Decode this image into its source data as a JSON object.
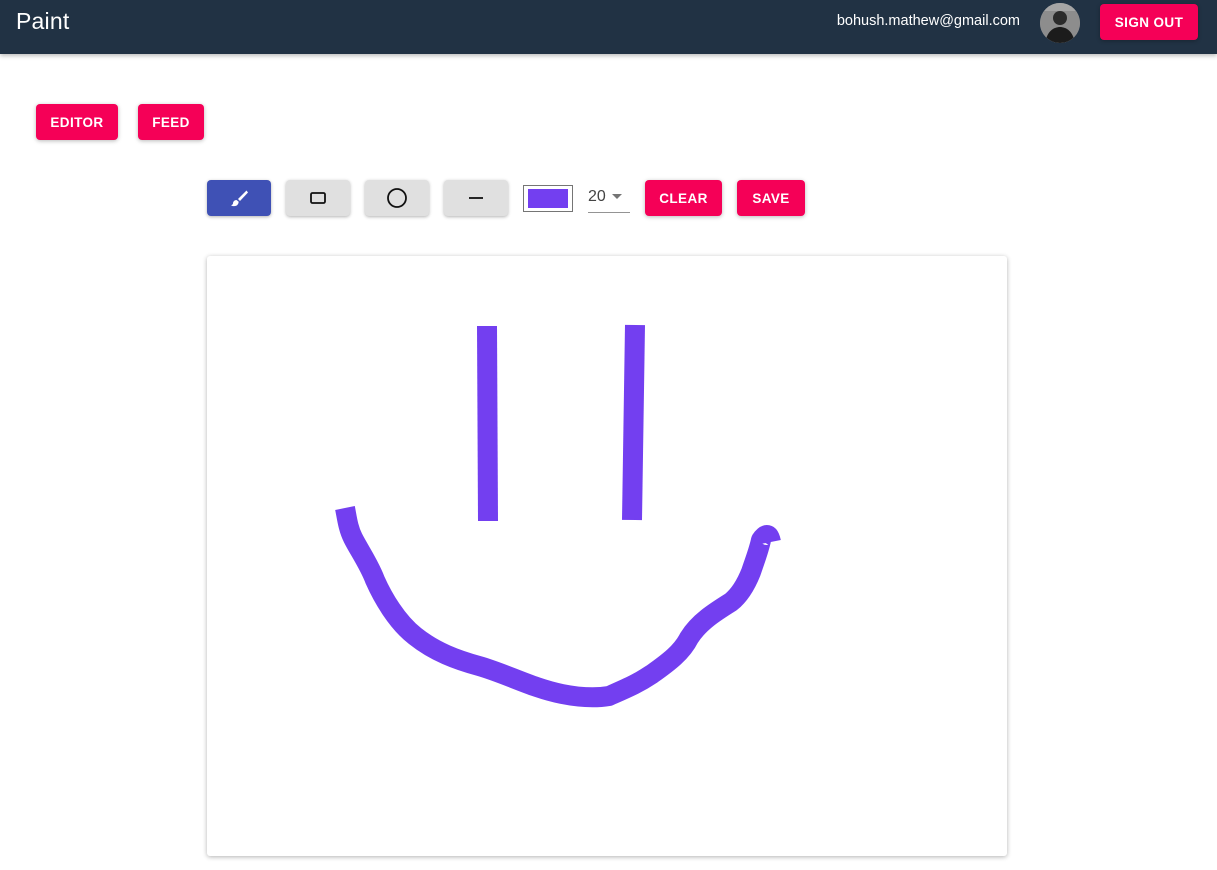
{
  "header": {
    "title": "Paint",
    "user_email": "bohush.mathew@gmail.com",
    "avatar_icon": "user-avatar",
    "sign_out_label": "SIGN OUT"
  },
  "nav": {
    "editor_label": "EDITOR",
    "feed_label": "FEED"
  },
  "toolbar": {
    "tools": [
      {
        "id": "brush",
        "icon": "brush-icon",
        "active": true
      },
      {
        "id": "rectangle",
        "icon": "rectangle-icon",
        "active": false
      },
      {
        "id": "circle",
        "icon": "circle-icon",
        "active": false
      },
      {
        "id": "line",
        "icon": "line-icon",
        "active": false
      }
    ],
    "color": "#733ff0",
    "brush_size": "20",
    "clear_label": "CLEAR",
    "save_label": "SAVE"
  },
  "theme": {
    "appbar": "#213244",
    "accent": "#f50057",
    "active_tool": "#3f51b5",
    "tool_bg": "#e0e0e0"
  }
}
